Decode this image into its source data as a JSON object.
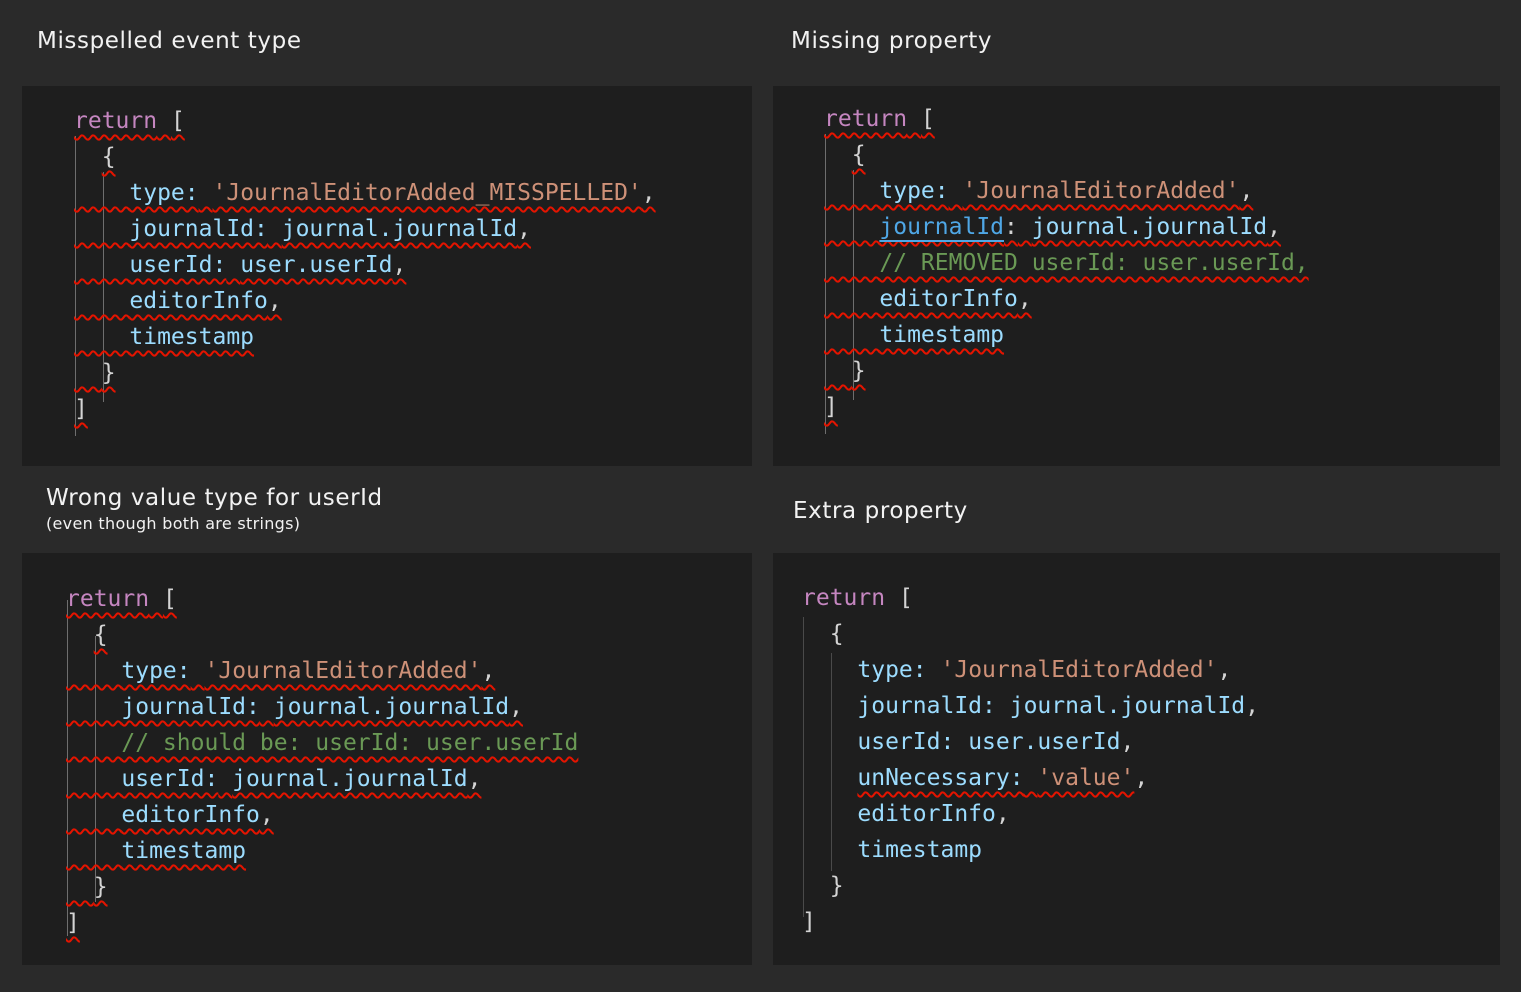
{
  "panels": {
    "p1": {
      "title": "Misspelled event type",
      "return_kw": "return",
      "open_bracket": "[",
      "open_brace": "{",
      "type_key": "type:",
      "type_val": "'JournalEditorAdded_MISSPELLED'",
      "journal_key": "journalId:",
      "journal_val": "journal.journalId",
      "user_key": "userId:",
      "user_val": "user.userId",
      "editor": "editorInfo",
      "timestamp": "timestamp",
      "close_brace": "}",
      "close_bracket": "]"
    },
    "p2": {
      "title": "Missing property",
      "return_kw": "return",
      "open_bracket": "[",
      "open_brace": "{",
      "type_key": "type:",
      "type_val": "'JournalEditorAdded'",
      "journal_key": "journalId",
      "journal_colon": ":",
      "journal_val": "journal.journalId",
      "comment": "// REMOVED userId: user.userId,",
      "editor": "editorInfo",
      "timestamp": "timestamp",
      "close_brace": "}",
      "close_bracket": "]"
    },
    "p3": {
      "title": "Wrong value type for userId",
      "subtitle": "(even though both are strings)",
      "return_kw": "return",
      "open_bracket": "[",
      "open_brace": "{",
      "type_key": "type:",
      "type_val": "'JournalEditorAdded'",
      "journal_key": "journalId:",
      "journal_val": "journal.journalId",
      "comment": "// should be: userId: user.userId",
      "user_key": "userId:",
      "user_val": "journal.journalId",
      "editor": "editorInfo",
      "timestamp": "timestamp",
      "close_brace": "}",
      "close_bracket": "]"
    },
    "p4": {
      "title": "Extra property",
      "return_kw": "return",
      "open_bracket": "[",
      "open_brace": "{",
      "type_key": "type:",
      "type_val": "'JournalEditorAdded'",
      "journal_key": "journalId:",
      "journal_val": "journal.journalId",
      "user_key": "userId:",
      "user_val": "user.userId",
      "extra_key": "unNecessary:",
      "extra_val": "'value'",
      "editor": "editorInfo",
      "timestamp": "timestamp",
      "close_brace": "}",
      "close_bracket": "]"
    }
  },
  "colors": {
    "background": "#2a2a2a",
    "panel": "#1e1e1e",
    "keyword": "#c586c0",
    "property": "#9cdcfe",
    "string": "#ce9178",
    "comment": "#6a9955",
    "squiggle": "#e51400",
    "heading": "#f2f2f2"
  }
}
